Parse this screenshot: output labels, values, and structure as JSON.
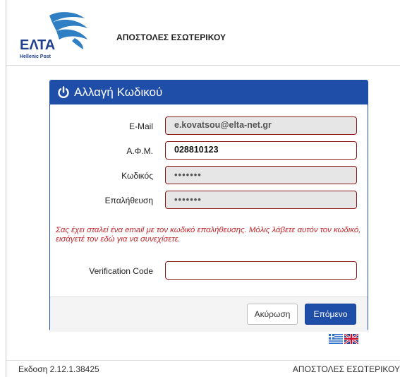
{
  "header": {
    "logo_text": "ΕΛΤΑ",
    "logo_subtext": "Hellenic Post",
    "title": "ΑΠΟΣΤΟΛΕΣ ΕΣΩΤΕΡΙΚΟΥ"
  },
  "panel": {
    "title": "Αλλαγή Κωδικού",
    "icon": "power-icon",
    "fields": {
      "email": {
        "label": "E-Mail",
        "value": "e.kovatsou@elta-net.gr"
      },
      "afm": {
        "label": "Α.Φ.Μ.",
        "value": "028810123"
      },
      "password": {
        "label": "Κωδικός",
        "value": "•••••••"
      },
      "confirm": {
        "label": "Επαλήθευση",
        "value": "•••••••"
      },
      "verification": {
        "label": "Verification Code",
        "value": ""
      }
    },
    "notice": "Σας έχει σταλεί ένα email με τον κωδικό επαλήθευσης. Μόλις λάβετε αυτόν τον κωδικό, εισάγετέ τον εδώ για να συνεχίσετε.",
    "buttons": {
      "cancel": "Ακύρωση",
      "next": "Επόμενο"
    }
  },
  "languages": [
    "greek-flag-icon",
    "uk-flag-icon"
  ],
  "footer": {
    "version": "Εκδοση 2.12.1.38425",
    "title": "ΑΠΟΣΤΟΛΕΣ ΕΣΩΤΕΡΙΚΟΥ"
  },
  "colors": {
    "brand_blue": "#1e4ea8",
    "input_border": "#8b1a1a",
    "notice_red": "#c0282d"
  }
}
